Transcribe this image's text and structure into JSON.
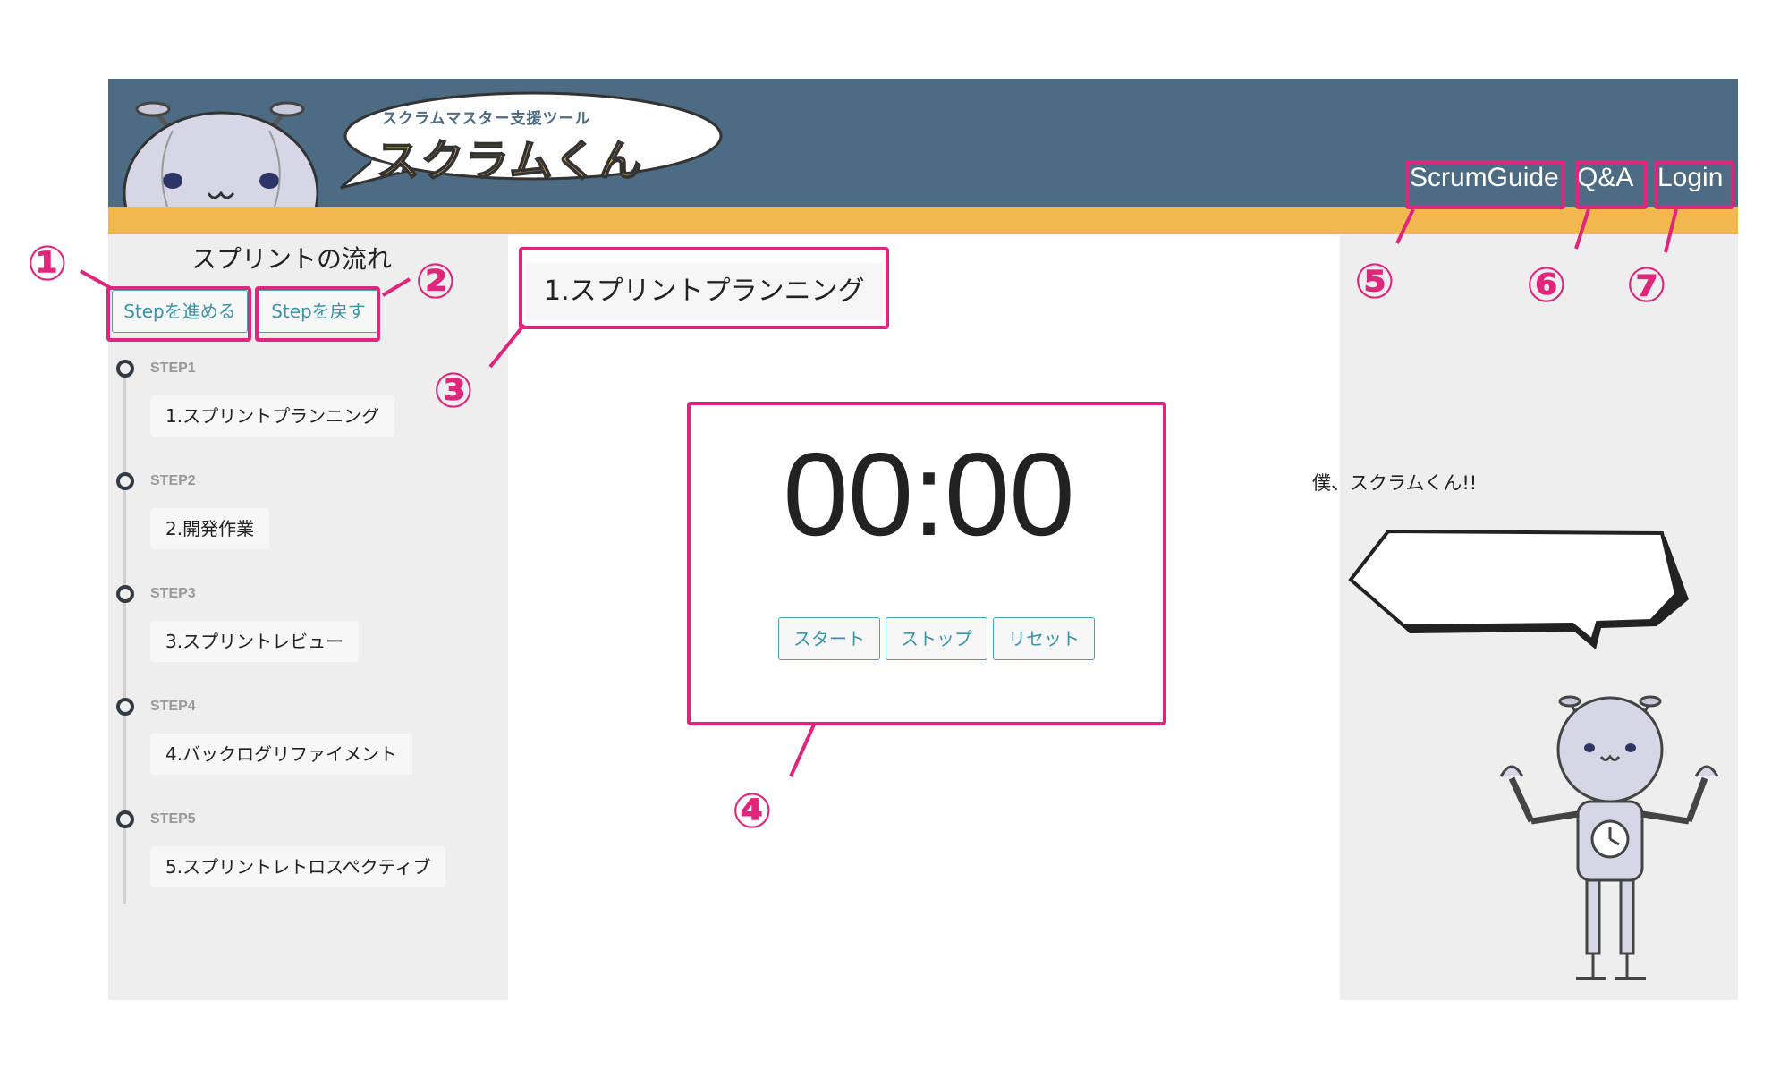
{
  "logo": {
    "subtitle": "スクラムマスター支援ツール",
    "title": "スクラムくん"
  },
  "nav": {
    "scrum_guide": "ScrumGuide",
    "qa": "Q&A",
    "login": "Login"
  },
  "sidebar": {
    "title": "スプリントの流れ",
    "next_button": "Stepを進める",
    "prev_button": "Stepを戻す",
    "steps": [
      {
        "label": "STEP1",
        "name": "1.スプリントプランニング"
      },
      {
        "label": "STEP2",
        "name": "2.開発作業"
      },
      {
        "label": "STEP3",
        "name": "3.スプリントレビュー"
      },
      {
        "label": "STEP4",
        "name": "4.バックログリファイメント"
      },
      {
        "label": "STEP5",
        "name": "5.スプリントレトロスペクティブ"
      }
    ]
  },
  "main": {
    "current_phase": "1.スプリントプランニング",
    "timer": "00:00",
    "start_button": "スタート",
    "stop_button": "ストップ",
    "reset_button": "リセット"
  },
  "mascot": {
    "speech": "僕、スクラムくん!!"
  },
  "annotations": [
    "①",
    "②",
    "③",
    "④",
    "⑤",
    "⑥",
    "⑦"
  ],
  "colors": {
    "header": "#4d6b82",
    "accent": "#f0b84f",
    "highlight": "#e0267c",
    "button_text": "#3b93a8"
  }
}
